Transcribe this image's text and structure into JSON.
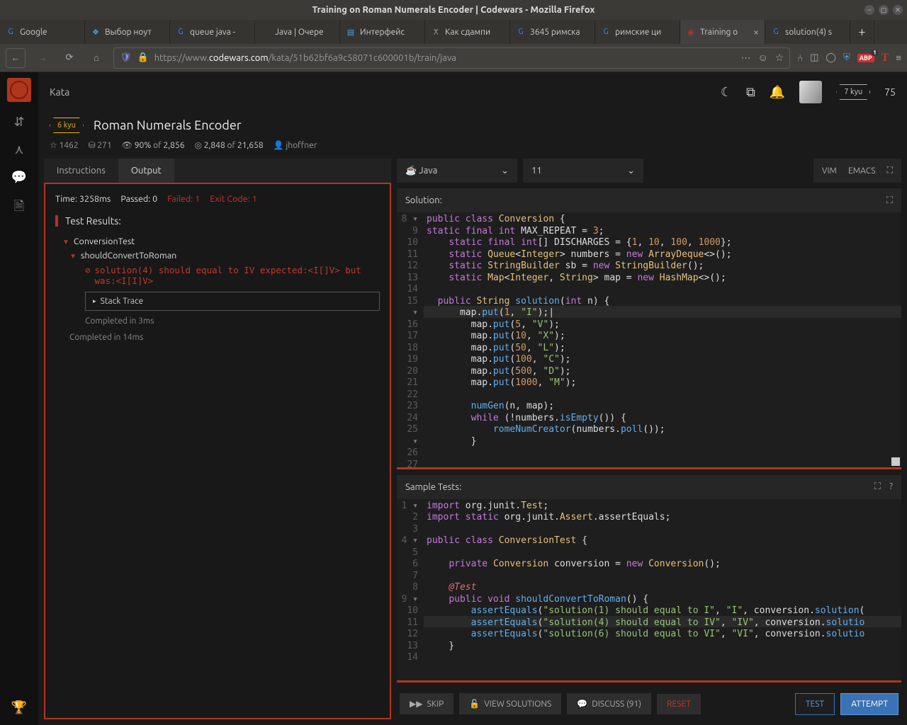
{
  "window_title": "Training on Roman Numerals Encoder | Codewars - Mozilla Firefox",
  "tabs": [
    {
      "fav": "G",
      "label": "Google",
      "color": "#4285f4"
    },
    {
      "fav": "❖",
      "label": "Выбор ноут",
      "color": "#4aa0e0"
    },
    {
      "fav": "G",
      "label": "queue java -",
      "color": "#4285f4"
    },
    {
      "fav": " ",
      "label": "Java | Очере",
      "color": "#888"
    },
    {
      "fav": "▤",
      "label": "Интерфейс",
      "color": "#4aa0e0"
    },
    {
      "fav": "ⵅ",
      "label": "Как сдампи",
      "color": "#888"
    },
    {
      "fav": "G",
      "label": "3645 римска",
      "color": "#4285f4"
    },
    {
      "fav": "G",
      "label": "римские ци",
      "color": "#4285f4"
    },
    {
      "fav": "◉",
      "label": "Training o",
      "color": "#b1361e",
      "active": true,
      "closeable": true
    },
    {
      "fav": "G",
      "label": "solution(4) s",
      "color": "#4285f4"
    }
  ],
  "url": {
    "proto": "https://",
    "host": "www.",
    "domain": "codewars.com",
    "path": "/kata/51b62bf6a9c58071c600001b/train/java"
  },
  "topnav": {
    "kata": "Kata",
    "kyu": "7 kyu",
    "honor": "75"
  },
  "kata": {
    "rank": "6 kyu",
    "title": "Roman Numerals Encoder",
    "stars": "1462",
    "collections": "271",
    "completion_pct": "90% of 2,856",
    "completion_pct_w": "90%",
    "completion_pct_of": " of ",
    "completion_pct_n": "2,856",
    "attempts_w": "2,848",
    "attempts_of": " of ",
    "attempts_n": "21,658",
    "author": "jhoffner"
  },
  "left": {
    "tab_instructions": "Instructions",
    "tab_output": "Output",
    "time": "Time: 3258ms",
    "passed": "Passed: 0",
    "failed": "Failed: 1",
    "exit": "Exit Code: 1",
    "test_results": "Test Results:",
    "suite": "ConversionTest",
    "case": "shouldConvertToRoman",
    "error": "solution(4) should equal to IV expected:<I[]V> but was:<I[I]V>",
    "stack": "Stack Trace",
    "done1": "Completed in 3ms",
    "done2": "Completed in 14ms"
  },
  "right": {
    "lang": "Java",
    "ver": "11",
    "vim": "VIM",
    "emacs": "EMACS",
    "solution_h": "Solution:",
    "tests_h": "Sample Tests:"
  },
  "solution": {
    "start": 8,
    "lines": [
      {
        "fold": "▾",
        "html": "<span class='kw'>public</span> <span class='kw'>class</span> <span class='type'>Conversion</span> {"
      },
      {
        "html": "<span class='kw'>static</span> <span class='kw'>final</span> <span class='kw'>int</span> MAX_REPEAT = <span class='num'>3</span>;"
      },
      {
        "html": "    <span class='kw'>static</span> <span class='kw'>final</span> <span class='kw'>int</span>[] DISCHARGES = {<span class='num'>1</span>, <span class='num'>10</span>, <span class='num'>100</span>, <span class='num'>1000</span>};"
      },
      {
        "html": "    <span class='kw'>static</span> <span class='type'>Queue</span>&lt;<span class='type'>Integer</span>&gt; numbers = <span class='kw'>new</span> <span class='type'>ArrayDeque</span>&lt;&gt;();"
      },
      {
        "html": "    <span class='kw'>static</span> <span class='type'>StringBuilder</span> sb = <span class='kw'>new</span> <span class='type'>StringBuilder</span>();"
      },
      {
        "html": "    <span class='kw'>static</span> <span class='type'>Map</span>&lt;<span class='type'>Integer</span>, <span class='type'>String</span>&gt; map = <span class='kw'>new</span> <span class='type'>HashMap</span>&lt;&gt;();"
      },
      {
        "html": ""
      },
      {
        "fold": "▾",
        "html": "  <span class='kw'>public</span> <span class='type'>String</span> <span class='fn'>solution</span>(<span class='kw'>int</span> n) {"
      },
      {
        "cur": true,
        "html": "      map.<span class='fn'>put</span>(<span class='num'>1</span>, <span class='str'>\"I\"</span>);<span class='caret'>|</span>"
      },
      {
        "html": "        map.<span class='fn'>put</span>(<span class='num'>5</span>, <span class='str'>\"V\"</span>);"
      },
      {
        "html": "        map.<span class='fn'>put</span>(<span class='num'>10</span>, <span class='str'>\"X\"</span>);"
      },
      {
        "html": "        map.<span class='fn'>put</span>(<span class='num'>50</span>, <span class='str'>\"L\"</span>);"
      },
      {
        "html": "        map.<span class='fn'>put</span>(<span class='num'>100</span>, <span class='str'>\"C\"</span>);"
      },
      {
        "html": "        map.<span class='fn'>put</span>(<span class='num'>500</span>, <span class='str'>\"D\"</span>);"
      },
      {
        "html": "        map.<span class='fn'>put</span>(<span class='num'>1000</span>, <span class='str'>\"M\"</span>);"
      },
      {
        "html": ""
      },
      {
        "html": "        <span class='fn'>numGen</span>(n, map);"
      },
      {
        "fold": "▾",
        "html": "        <span class='kw'>while</span> (!numbers.<span class='fn'>isEmpty</span>()) {"
      },
      {
        "html": "            <span class='fn'>romeNumCreator</span>(numbers.<span class='fn'>poll</span>());"
      },
      {
        "html": "        }"
      },
      {
        "html": ""
      },
      {
        "html": ""
      }
    ]
  },
  "tests": {
    "start": 1,
    "lines": [
      {
        "fold": "▾",
        "html": "<span class='kw'>import</span> org.junit.<span class='type'>Test</span>;"
      },
      {
        "html": "<span class='kw'>import</span> <span class='kw'>static</span> org.junit.<span class='type'>Assert</span>.assertEquals;"
      },
      {
        "html": ""
      },
      {
        "fold": "▾",
        "html": "<span class='kw'>public</span> <span class='kw'>class</span> <span class='type'>ConversionTest</span> {"
      },
      {
        "html": ""
      },
      {
        "html": "    <span class='kw'>private</span> <span class='type'>Conversion</span> conversion = <span class='kw'>new</span> <span class='type'>Conversion</span>();"
      },
      {
        "html": ""
      },
      {
        "html": "    <span class='an'>@Test</span>"
      },
      {
        "fold": "▾",
        "html": "    <span class='kw'>public</span> <span class='kw'>void</span> <span class='fn'>shouldConvertToRoman</span>() {"
      },
      {
        "html": "        <span class='fn'>assertEquals</span>(<span class='str'>\"solution(1) should equal to I\"</span>, <span class='str'>\"I\"</span>, conversion.<span class='fn'>solution</span>("
      },
      {
        "cur": true,
        "html": "        <span class='fn'>assertEquals</span>(<span class='str'>\"solution(4) should equal to IV\"</span>, <span class='str'>\"IV\"</span>, conversion.<span class='fn'>solutio</span>"
      },
      {
        "html": "        <span class='fn'>assertEquals</span>(<span class='str'>\"solution(6) should equal to VI\"</span>, <span class='str'>\"VI\"</span>, conversion.<span class='fn'>solutio</span>"
      },
      {
        "html": "    }"
      },
      {
        "html": ""
      }
    ]
  },
  "actions": {
    "skip": "SKIP",
    "view": "VIEW SOLUTIONS",
    "discuss": "DISCUSS (91)",
    "reset": "RESET",
    "test": "TEST",
    "attempt": "ATTEMPT"
  }
}
